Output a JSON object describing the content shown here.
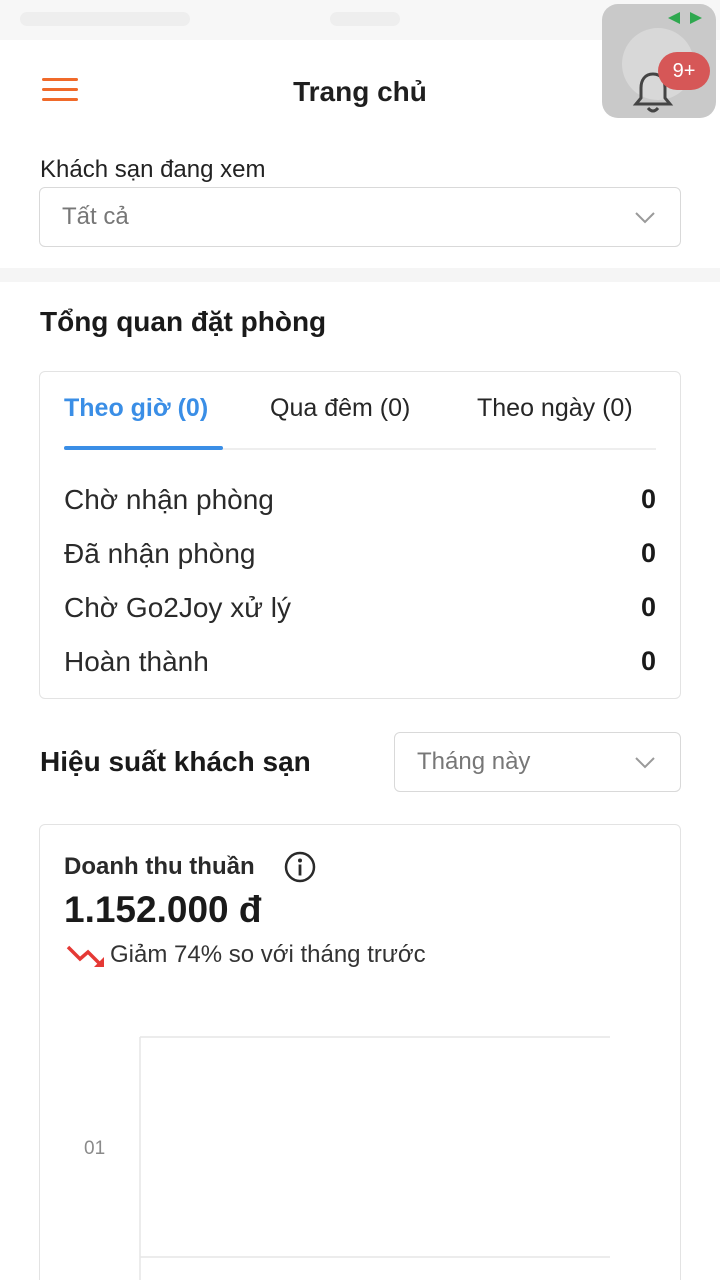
{
  "header": {
    "title": "Trang chủ",
    "notification_count": "9+"
  },
  "hotel_filter": {
    "label": "Khách sạn đang xem",
    "selected": "Tất cả"
  },
  "booking_overview": {
    "title": "Tổng quan đặt phòng",
    "tabs": [
      {
        "label": "Theo giờ (0)",
        "active": true
      },
      {
        "label": "Qua đêm (0)",
        "active": false
      },
      {
        "label": "Theo ngày (0)",
        "active": false
      }
    ],
    "stats": [
      {
        "label": "Chờ nhận phòng",
        "value": "0"
      },
      {
        "label": "Đã nhận phòng",
        "value": "0"
      },
      {
        "label": "Chờ Go2Joy xử lý",
        "value": "0"
      },
      {
        "label": "Hoàn thành",
        "value": "0"
      }
    ]
  },
  "performance": {
    "title": "Hiệu suất khách sạn",
    "period_selected": "Tháng này",
    "revenue_label": "Doanh thu thuần",
    "revenue_value": "1.152.000 đ",
    "trend_text": "Giảm 74% so với tháng trước",
    "trend_color": "#e53935"
  },
  "chart_data": {
    "type": "bar",
    "categories": [],
    "values": [],
    "y_ticks": [
      "01"
    ],
    "grid": true
  },
  "colors": {
    "accent": "#3a8ee6",
    "brand": "#f06a2a"
  }
}
